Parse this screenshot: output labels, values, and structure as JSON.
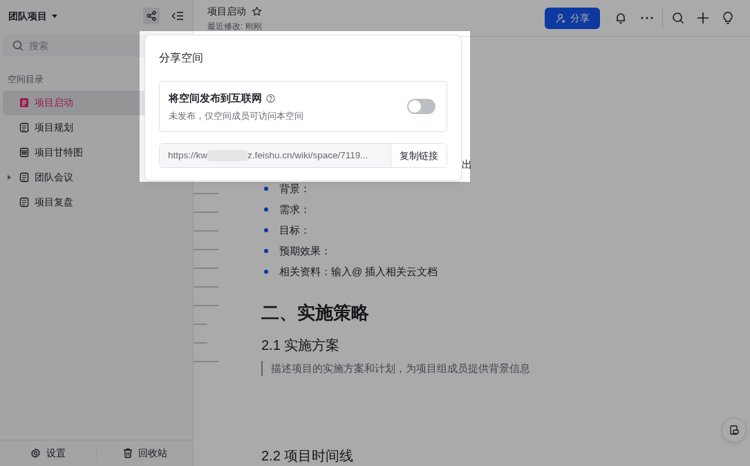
{
  "sidebar": {
    "title": "团队项目",
    "search": {
      "placeholder": "搜索"
    },
    "section_label": "空间目录",
    "items": [
      {
        "label": "项目启动",
        "kind": "doc",
        "selected": true,
        "expandable": false
      },
      {
        "label": "项目规划",
        "kind": "doc",
        "selected": false,
        "expandable": false
      },
      {
        "label": "项目甘特图",
        "kind": "gantt",
        "selected": false,
        "expandable": false
      },
      {
        "label": "团队会议",
        "kind": "doc",
        "selected": false,
        "expandable": true
      },
      {
        "label": "项目复盘",
        "kind": "doc",
        "selected": false,
        "expandable": false
      }
    ],
    "footer": [
      {
        "label": "设置",
        "kind": "settings"
      },
      {
        "label": "回收站",
        "kind": "trash"
      }
    ]
  },
  "document": {
    "title": "项目启动",
    "starred": false,
    "modified": "最近修改: 刚刚",
    "share_button": "分享",
    "blocks": [
      {
        "kind": "fragment",
        "text": "出"
      },
      {
        "kind": "bullet",
        "text": "背景："
      },
      {
        "kind": "bullet",
        "text": "需求："
      },
      {
        "kind": "bullet",
        "text": "目标："
      },
      {
        "kind": "bullet",
        "text": "预期效果："
      },
      {
        "kind": "bullet",
        "text": "相关资料：输入@ 插入相关云文档"
      },
      {
        "kind": "h1",
        "text": "二、实施策略"
      },
      {
        "kind": "h2",
        "text": "2.1 实施方案"
      },
      {
        "kind": "quote",
        "text": "描述项目的实施方案和计划，为项目组成员提供背景信息"
      },
      {
        "kind": "h2",
        "text": "2.2 项目时间线"
      }
    ]
  },
  "share_dialog": {
    "title": "分享空间",
    "publish_label": "将空间发布到互联网",
    "publish_description": "未发布，仅空间成员可访问本空间",
    "published": false,
    "link_start": "https://kw",
    "link_end": "z.feishu.cn/wiki/space/7119...",
    "copy_button": "复制链接"
  }
}
